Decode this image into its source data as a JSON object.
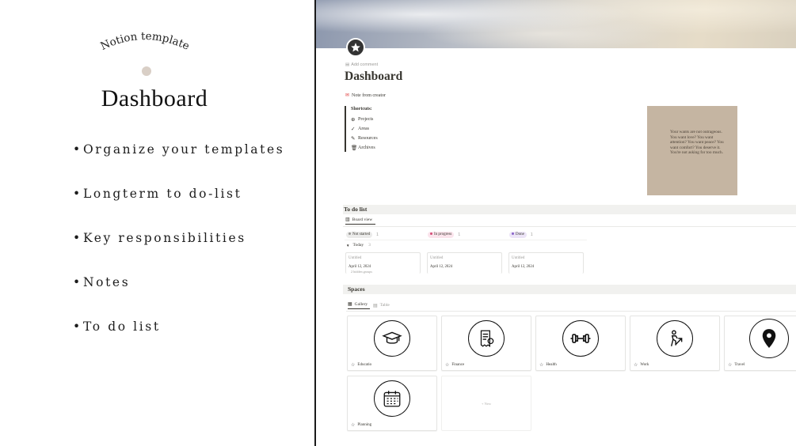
{
  "promo": {
    "arc_title": "Notion template",
    "title": "Dashboard",
    "features": [
      "Organize your templates",
      "Longterm to do-list",
      "Key responsibilities",
      "Notes",
      "To do list"
    ]
  },
  "page": {
    "icon": "star-badge-icon",
    "add_comment": "Add comment",
    "title": "Dashboard",
    "note_from_creator": "Note from creator",
    "shortcuts": {
      "title": "Shortcuts:",
      "items": [
        {
          "icon": "compass-icon",
          "glyph": "⊕",
          "label": "Projects"
        },
        {
          "icon": "check-icon",
          "glyph": "✓",
          "label": "Areas"
        },
        {
          "icon": "pencil-icon",
          "glyph": "✎",
          "label": "Resources"
        },
        {
          "icon": "trash-icon",
          "glyph": "🗑",
          "label": "Archives"
        }
      ]
    },
    "quote": {
      "text": "Your wants are not outrageous. You want love? You want attention? You want peace? You want comfort? You deserve it. You're not asking for too much."
    },
    "todo": {
      "section_title": "To do list",
      "view_tab": "Board view",
      "statuses": [
        {
          "label": "Not started",
          "count": "1",
          "bg": "#ebebea",
          "dot": "#9b9a97"
        },
        {
          "label": "In progress",
          "count": "1",
          "bg": "#fbe4ec",
          "dot": "#d44c77"
        },
        {
          "label": "Done",
          "count": "1",
          "bg": "#ece4f7",
          "dot": "#8a63c9"
        }
      ],
      "group": {
        "label": "Today",
        "count": "3"
      },
      "cards": [
        {
          "title": "Untitled",
          "date": "April 12, 2024",
          "sub": "2 hidden groups"
        },
        {
          "title": "Untitled",
          "date": "April 12, 2024",
          "sub": ""
        },
        {
          "title": "Untitled",
          "date": "April 12, 2024",
          "sub": ""
        }
      ]
    },
    "spaces": {
      "section_title": "Spaces",
      "tabs": {
        "gallery": "Gallery",
        "table": "Table"
      },
      "cards": [
        {
          "name": "Educatio",
          "icon": "graduation-cap-icon"
        },
        {
          "name": "Finance",
          "icon": "receipt-icon"
        },
        {
          "name": "Health",
          "icon": "dumbbell-icon"
        },
        {
          "name": "Work",
          "icon": "growth-person-icon"
        },
        {
          "name": "Travel",
          "icon": "location-pin-icon"
        },
        {
          "name": "Planning",
          "icon": "calendar-icon"
        }
      ],
      "new_label": "+ New"
    }
  },
  "colors": {
    "divider": "#1a1a1a",
    "promo_dot": "#d9cfc6",
    "quote_card": "#c5b5a2",
    "section_bar": "#f1f1ef"
  }
}
